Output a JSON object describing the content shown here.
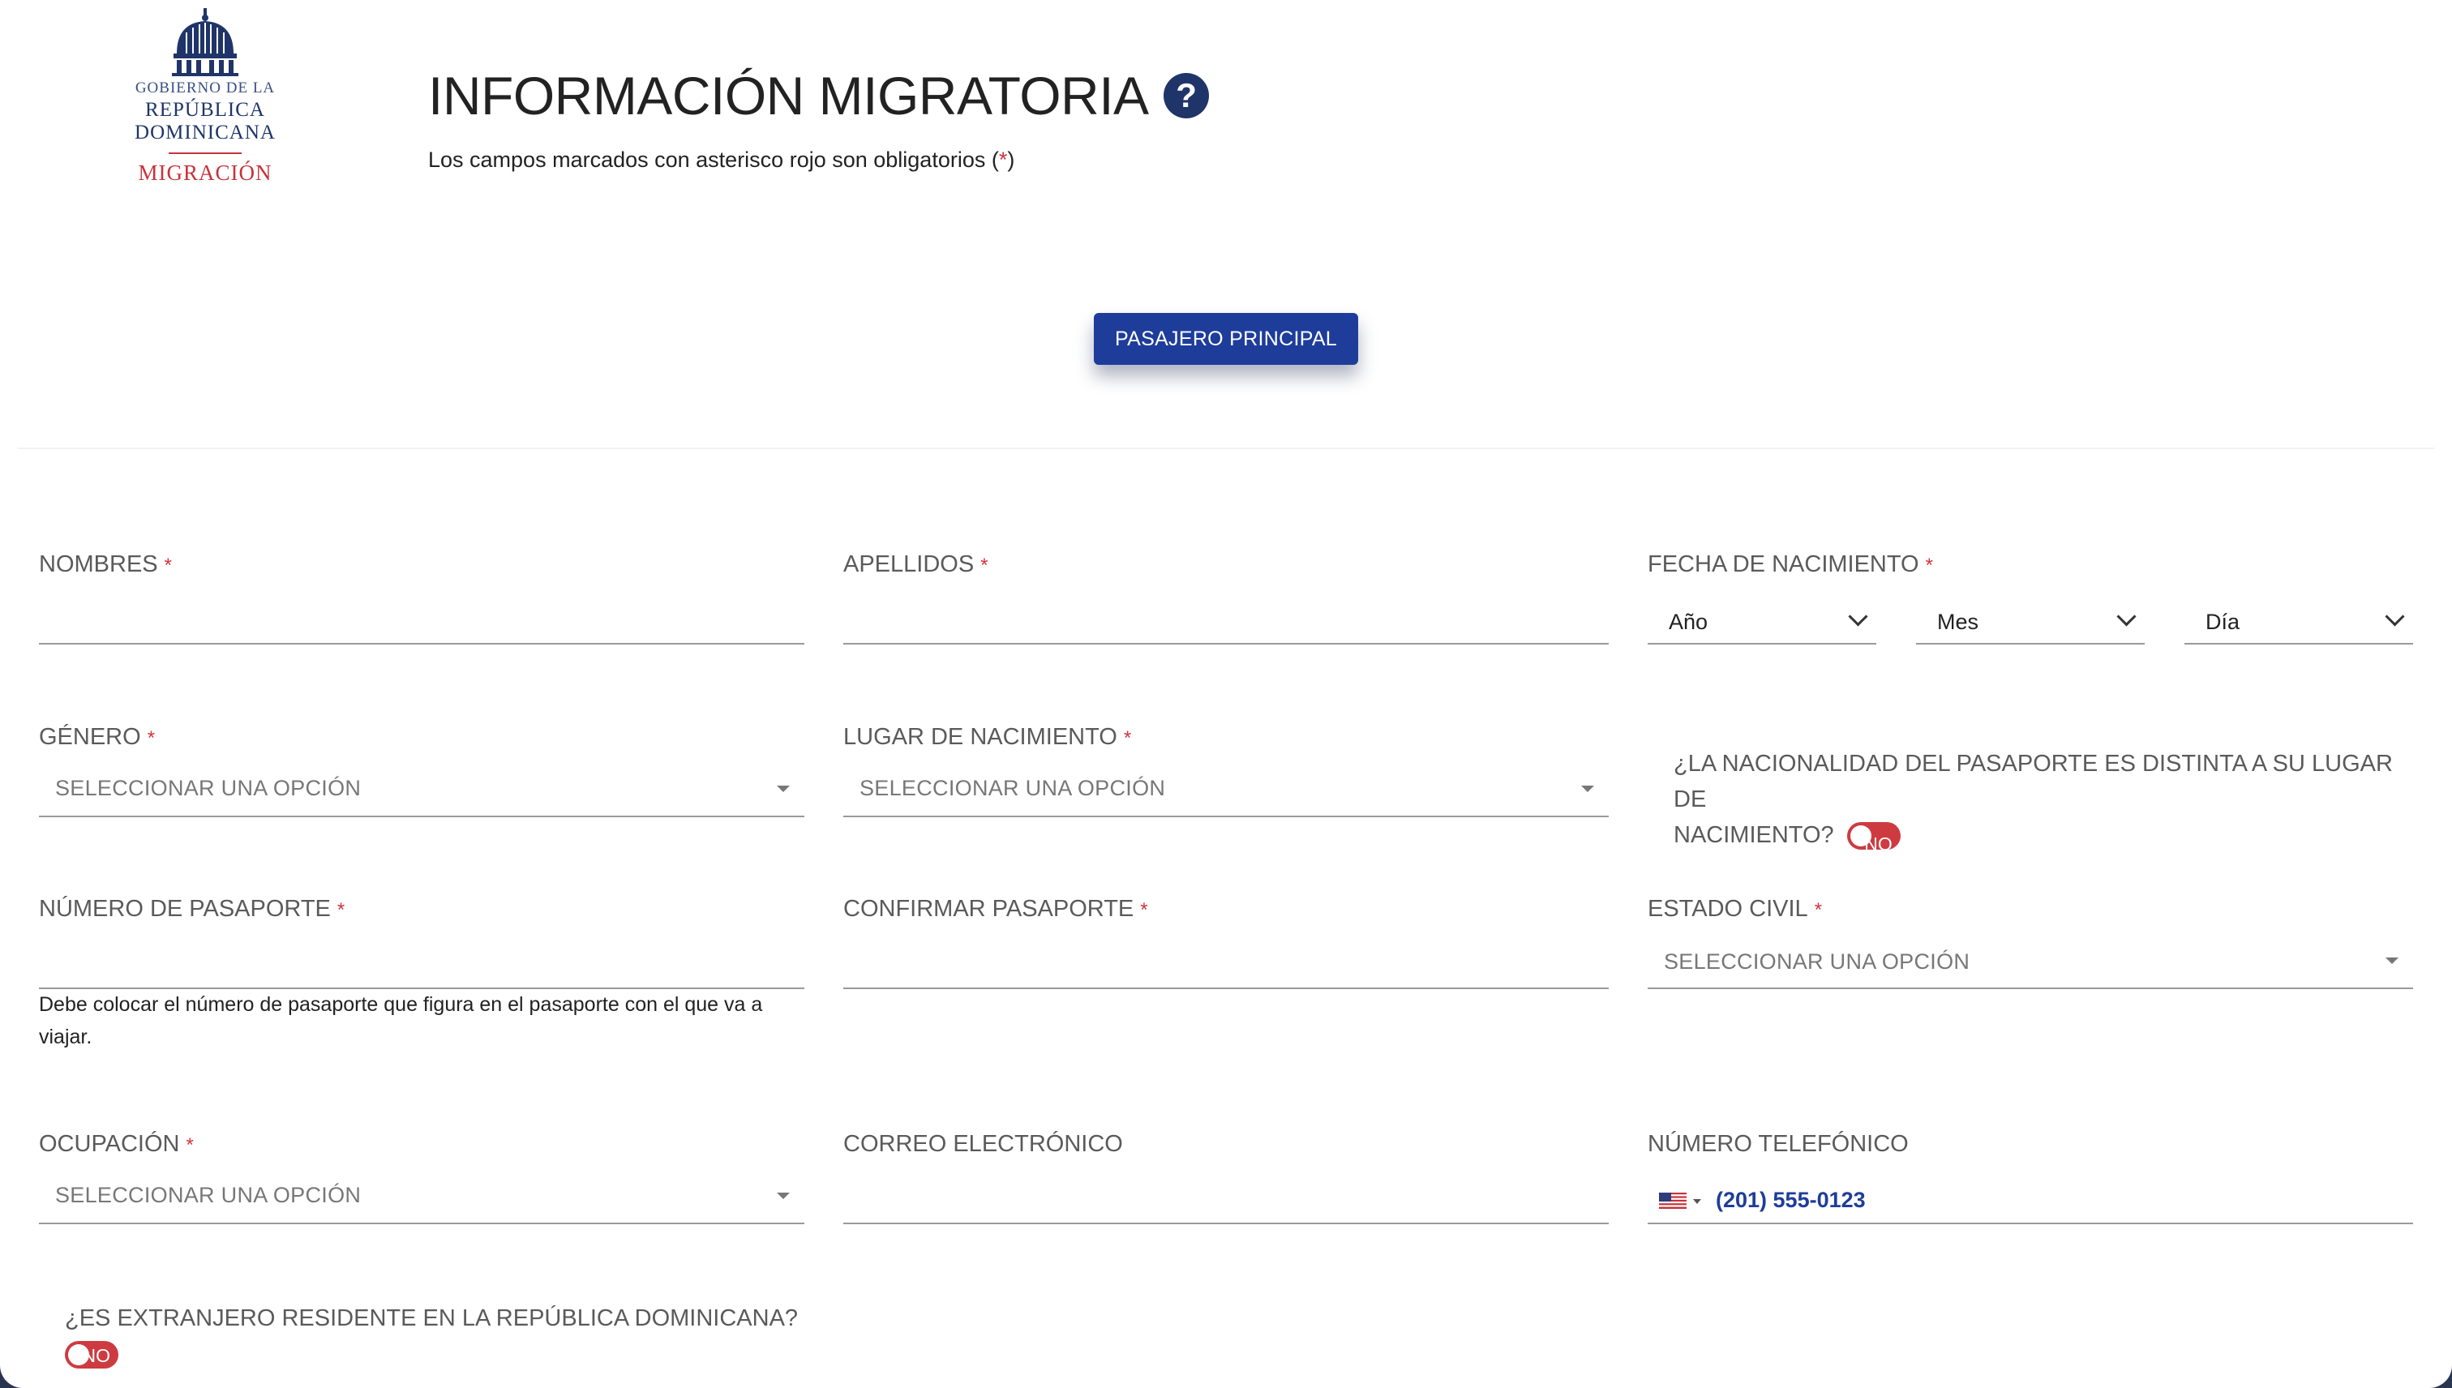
{
  "logo": {
    "line1": "GOBIERNO DE LA",
    "line2": "REPÚBLICA DOMINICANA",
    "line3": "MIGRACIÓN"
  },
  "header": {
    "title": "INFORMACIÓN MIGRATORIA",
    "help_icon": "question-circle-icon",
    "subtitle_before": "Los campos marcados con asterisco rojo son obligatorios (",
    "subtitle_star": "*",
    "subtitle_after": ")"
  },
  "passenger_button": "PASAJERO PRINCIPAL",
  "required_mark": "*",
  "fields": {
    "nombres": {
      "label": "NOMBRES",
      "value": ""
    },
    "apellidos": {
      "label": "APELLIDOS",
      "value": ""
    },
    "fecha_nacimiento": {
      "label": "FECHA DE NACIMIENTO",
      "year": "Año",
      "month": "Mes",
      "day": "Día"
    },
    "genero": {
      "label": "GÉNERO",
      "value": "SELECCIONAR UNA OPCIÓN"
    },
    "lugar_nacimiento": {
      "label": "LUGAR DE NACIMIENTO",
      "value": "SELECCIONAR UNA OPCIÓN"
    },
    "nacionalidad_distinta": {
      "question_line1": "¿LA NACIONALIDAD DEL PASAPORTE ES DISTINTA A SU LUGAR DE",
      "question_line2": "NACIMIENTO?",
      "toggle": "NO"
    },
    "numero_pasaporte": {
      "label": "NÚMERO DE PASAPORTE",
      "value": "",
      "help_line1": "Debe colocar el número de pasaporte que figura en el pasaporte con el que va a",
      "help_line2": "viajar."
    },
    "confirmar_pasaporte": {
      "label": "CONFIRMAR PASAPORTE",
      "value": ""
    },
    "estado_civil": {
      "label": "ESTADO CIVIL",
      "value": "SELECCIONAR UNA OPCIÓN"
    },
    "ocupacion": {
      "label": "OCUPACIÓN",
      "value": "SELECCIONAR UNA OPCIÓN"
    },
    "correo": {
      "label": "CORREO ELECTRÓNICO",
      "value": ""
    },
    "telefono": {
      "label": "NÚMERO TELEFÓNICO",
      "flag": "us-flag-icon",
      "value": "(201) 555-0123"
    },
    "extranjero_residente": {
      "question": "¿ES EXTRANJERO RESIDENTE EN LA REPÚBLICA DOMINICANA?",
      "toggle": "NO"
    }
  },
  "colors": {
    "primary": "#1e3d9b",
    "required": "#d0343b",
    "toggle_off": "#cd3b40",
    "brand_navy": "#1f3569"
  }
}
